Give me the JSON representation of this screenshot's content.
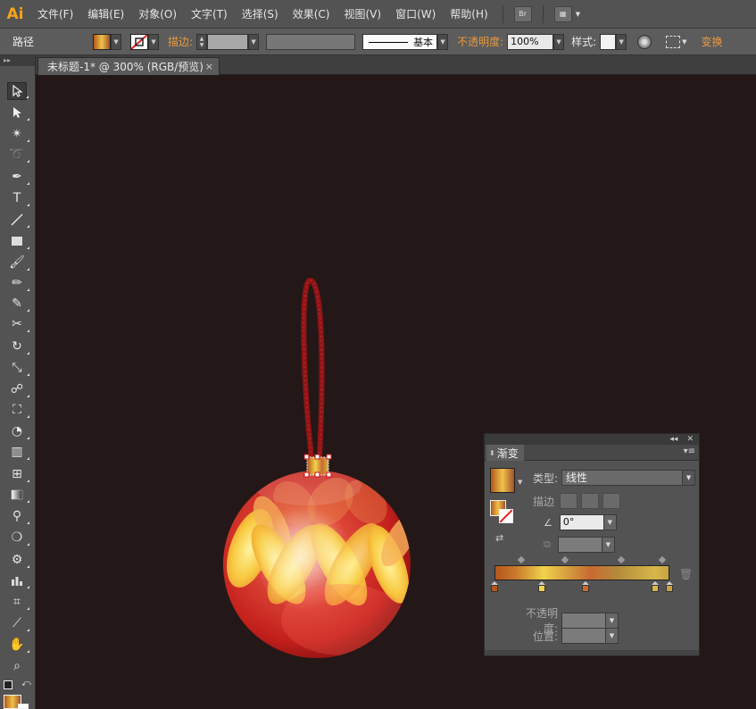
{
  "app": {
    "logo": "Ai"
  },
  "menu": [
    "文件(F)",
    "编辑(E)",
    "对象(O)",
    "文字(T)",
    "选择(S)",
    "效果(C)",
    "视图(V)",
    "窗口(W)",
    "帮助(H)"
  ],
  "menu_extra": {
    "bridge_label": "Br"
  },
  "controlbar": {
    "path_label": "路径",
    "stroke_label": "描边:",
    "stroke_style": "基本",
    "opacity_label": "不透明度:",
    "opacity_value": "100%",
    "style_label": "样式:",
    "transform_label": "变换"
  },
  "document": {
    "tab_title": "未标题-1* @ 300% (RGB/预览)",
    "close": "×"
  },
  "gradient_panel": {
    "title": "渐变",
    "type_label": "类型:",
    "type_value": "线性",
    "stroke_label": "描边",
    "angle_value": "0°",
    "opacity_label": "不透明度:",
    "position_label": "位置:",
    "stops": [
      {
        "color": "#b5561c",
        "position": 0
      },
      {
        "color": "#f1d34c",
        "position": 27
      },
      {
        "color": "#c86a30",
        "position": 52
      },
      {
        "color": "#d7b74a",
        "position": 92
      },
      {
        "color": "#c8a340",
        "position": 100
      }
    ]
  },
  "colors": {
    "accent_orange": "#e89a3c",
    "canvas": "#231817",
    "panel": "#535353"
  }
}
